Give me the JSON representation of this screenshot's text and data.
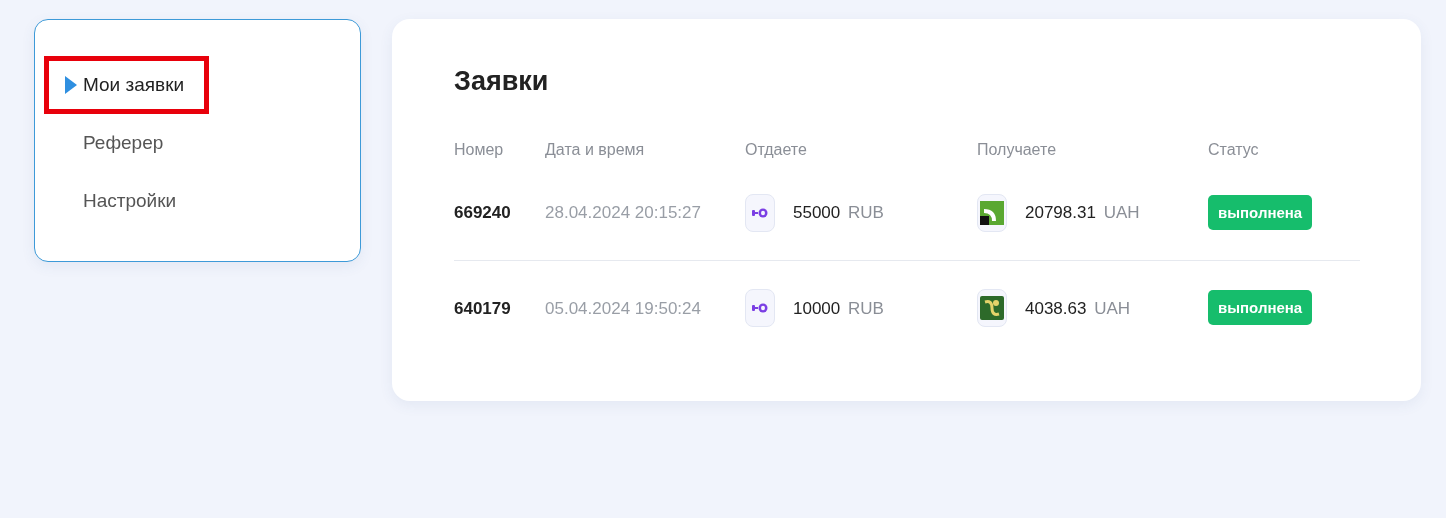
{
  "sidebar": {
    "items": [
      {
        "label": "Мои заявки",
        "selected": true,
        "highlighted": true
      },
      {
        "label": "Реферер",
        "selected": false,
        "highlighted": false
      },
      {
        "label": "Настройки",
        "selected": false,
        "highlighted": false
      }
    ]
  },
  "orders": {
    "title": "Заявки",
    "columns": [
      "Номер",
      "Дата и время",
      "Отдаете",
      "Получаете",
      "Статус"
    ],
    "rows": [
      {
        "number": "669240",
        "datetime": "28.04.2024 20:15:27",
        "give": {
          "kind": "yoomoney",
          "amount": "55000",
          "currency": "RUB"
        },
        "get": {
          "kind": "privat",
          "amount": "20798.31",
          "currency": "UAH"
        },
        "status": {
          "kind": "done",
          "label": "выполнена"
        }
      },
      {
        "number": "640179",
        "datetime": "05.04.2024 19:50:24",
        "give": {
          "kind": "yoomoney",
          "amount": "10000",
          "currency": "RUB"
        },
        "get": {
          "kind": "oschad",
          "amount": "4038.63",
          "currency": "UAH"
        },
        "status": {
          "kind": "done",
          "label": "выполнена"
        }
      }
    ]
  }
}
